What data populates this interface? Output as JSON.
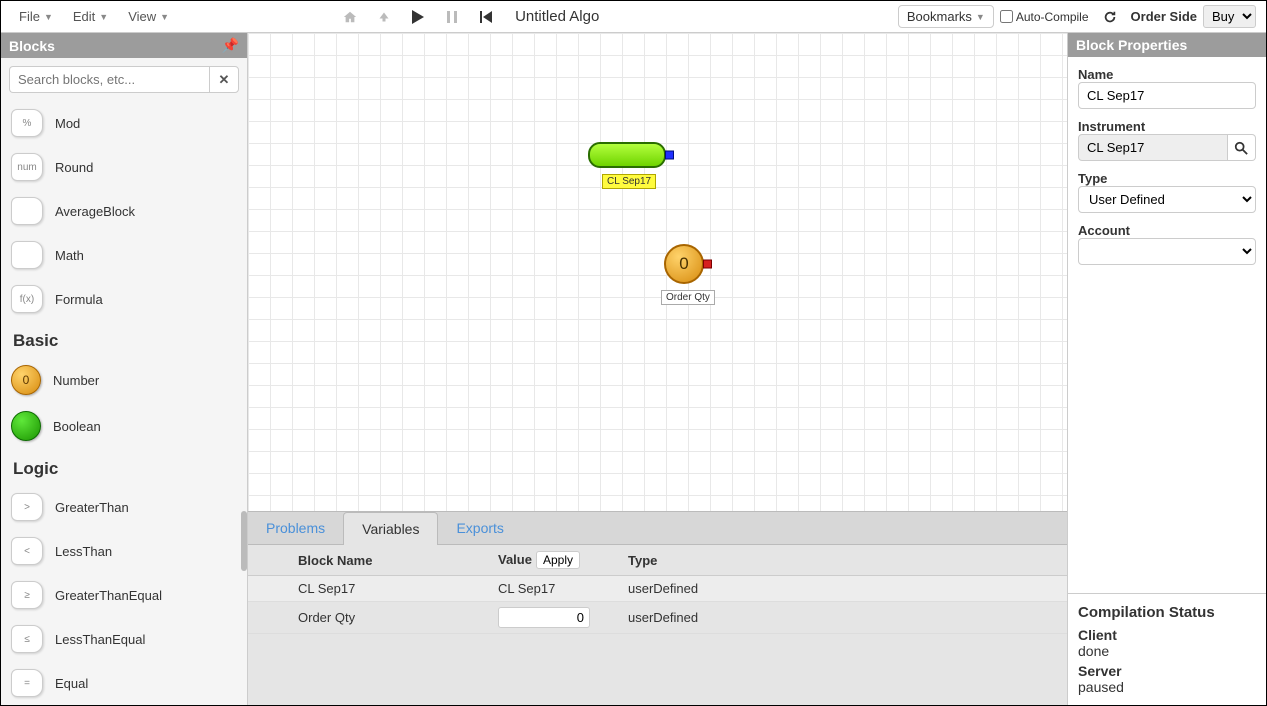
{
  "menubar": {
    "file": "File",
    "edit": "Edit",
    "view": "View",
    "title": "Untitled Algo",
    "bookmarks": "Bookmarks",
    "auto_compile": "Auto-Compile",
    "order_side_label": "Order Side",
    "order_side_value": "Buy"
  },
  "sidebar": {
    "title": "Blocks",
    "search_placeholder": "Search blocks, etc...",
    "groups": {
      "math": [
        {
          "name": "Mod",
          "icon_text": "%"
        },
        {
          "name": "Round",
          "icon_text": "num"
        },
        {
          "name": "AverageBlock",
          "icon_text": ""
        },
        {
          "name": "Math",
          "icon_text": ""
        },
        {
          "name": "Formula",
          "icon_text": "f(x)"
        }
      ],
      "basic_header": "Basic",
      "basic": [
        {
          "name": "Number",
          "type": "number",
          "icon_text": "0"
        },
        {
          "name": "Boolean",
          "type": "boolean",
          "icon_text": ""
        }
      ],
      "logic_header": "Logic",
      "logic": [
        {
          "name": "GreaterThan",
          "icon_text": ">"
        },
        {
          "name": "LessThan",
          "icon_text": "<"
        },
        {
          "name": "GreaterThanEqual",
          "icon_text": "≥"
        },
        {
          "name": "LessThanEqual",
          "icon_text": "≤"
        },
        {
          "name": "Equal",
          "icon_text": "="
        }
      ]
    }
  },
  "canvas": {
    "instr_block": {
      "label": "CL Sep17"
    },
    "order_block": {
      "value": "0",
      "label": "Order Qty"
    }
  },
  "bottom": {
    "tabs": {
      "problems": "Problems",
      "variables": "Variables",
      "exports": "Exports"
    },
    "columns": {
      "block_name": "Block Name",
      "value": "Value",
      "apply": "Apply",
      "type": "Type"
    },
    "rows": [
      {
        "block_name": "CL Sep17",
        "value": "CL Sep17",
        "value_editable": false,
        "type": "userDefined"
      },
      {
        "block_name": "Order Qty",
        "value": "0",
        "value_editable": true,
        "type": "userDefined"
      }
    ]
  },
  "properties": {
    "panel_title": "Block Properties",
    "name_label": "Name",
    "name_value": "CL Sep17",
    "instrument_label": "Instrument",
    "instrument_value": "CL Sep17",
    "type_label": "Type",
    "type_value": "User Defined",
    "account_label": "Account",
    "account_value": ""
  },
  "status": {
    "heading": "Compilation Status",
    "client_label": "Client",
    "client_value": "done",
    "server_label": "Server",
    "server_value": "paused"
  }
}
